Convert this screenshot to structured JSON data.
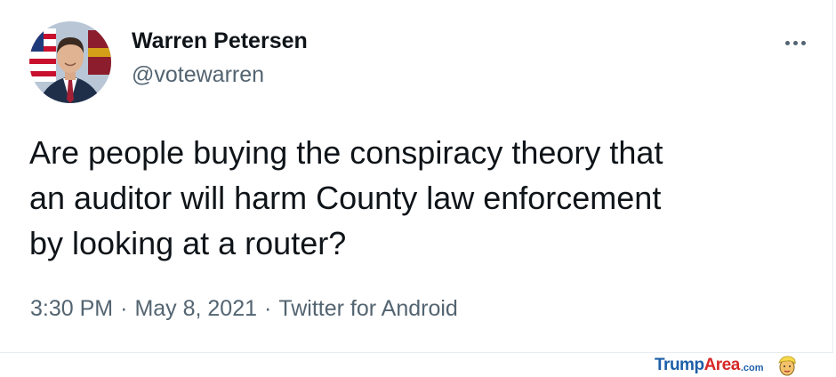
{
  "tweet": {
    "author": {
      "display_name": "Warren Petersen",
      "handle": "@votewarren",
      "avatar": "profile-photo"
    },
    "text_lines": [
      "Are people buying the conspiracy theory that",
      "an auditor will harm County law enforcement",
      "by looking at a router?"
    ],
    "meta": {
      "time": "3:30 PM",
      "separator": "·",
      "date": "May 8, 2021",
      "source": "Twitter for Android"
    },
    "more_icon": "more-horizontal-icon"
  },
  "watermark": {
    "part1": "Trump",
    "part2": "Area",
    "suffix": ".com",
    "icon": "cartoon-face-icon"
  },
  "colors": {
    "text_primary": "#0f1419",
    "text_secondary": "#536471",
    "watermark_blue": "#1d5fa8",
    "watermark_red": "#d62828"
  }
}
